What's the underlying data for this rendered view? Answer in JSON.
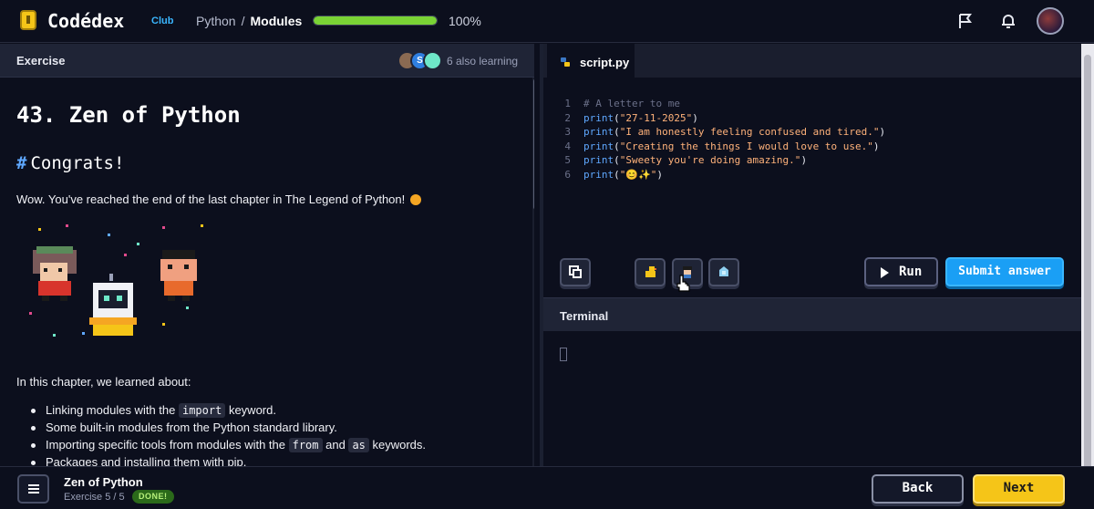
{
  "header": {
    "logo_text": "Codédex",
    "logo_sub": "Club",
    "breadcrumb": [
      "Python",
      "Modules"
    ],
    "breadcrumb_sep": "/",
    "progress": 1.0,
    "progress_text": "100%"
  },
  "left": {
    "panel_title": "Exercise",
    "learners_text": "6 also learning",
    "avatar_letter": "S",
    "title": "43. Zen of Python",
    "section_hash": "#",
    "section_title": "Congrats!",
    "intro": "Wow. You've reached the end of the last chapter in The Legend of Python!",
    "learned_intro": "In this chapter, we learned about:",
    "bullets": [
      {
        "pre": "Linking modules with the ",
        "code": "import",
        "post": " keyword."
      },
      {
        "pre": "Some built-in modules from the Python standard library.",
        "code": "",
        "post": ""
      },
      {
        "pre": "Importing specific tools from modules with the ",
        "code": "from",
        "mid": " and ",
        "code2": "as",
        "post": " keywords."
      },
      {
        "pre": "Packages and installing them with pip.",
        "code": "",
        "post": ""
      }
    ]
  },
  "editor": {
    "tab_label": "script.py",
    "lines": [
      {
        "n": "1",
        "comment": "# A letter to me"
      },
      {
        "n": "2",
        "fn": "print",
        "str": "\"27-11-2025\""
      },
      {
        "n": "3",
        "fn": "print",
        "str": "\"I am honestly feeling confused and tired.\""
      },
      {
        "n": "4",
        "fn": "print",
        "str": "\"Creating the things I would love to use.\""
      },
      {
        "n": "5",
        "fn": "print",
        "str": "\"Sweety you're doing amazing.\""
      },
      {
        "n": "6",
        "fn": "print",
        "str": "\"😊✨\""
      }
    ],
    "run_label": "Run",
    "submit_label": "Submit answer"
  },
  "terminal": {
    "title": "Terminal"
  },
  "footer": {
    "exercise_title": "Zen of Python",
    "exercise_count": "Exercise 5 / 5",
    "status_badge": "DONE!",
    "back_label": "Back",
    "next_label": "Next"
  },
  "colors": {
    "accent_blue": "#1a9ff5",
    "accent_yellow": "#f5c518",
    "progress_green": "#7ad335"
  }
}
